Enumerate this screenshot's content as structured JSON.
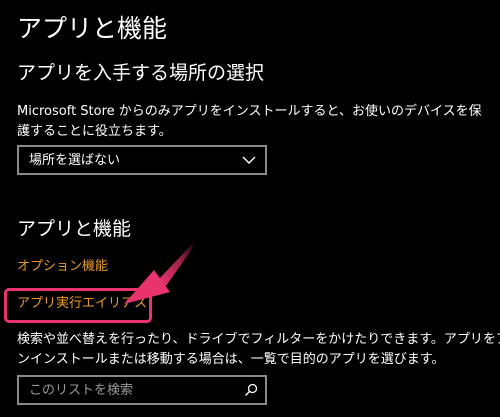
{
  "page": {
    "title": "アプリと機能"
  },
  "install_source": {
    "title": "アプリを入手する場所の選択",
    "description_lines": [
      "Microsoft Store からのみアプリをインストールすると、お使いのデバイスを保",
      "護することに役立ちます。"
    ],
    "dropdown_value": "場所を選ばない"
  },
  "apps_features": {
    "title": "アプリと機能",
    "links": {
      "optional_features": "オプション機能",
      "execution_alias": "アプリ実行エイリアス"
    },
    "description_lines": [
      "検索や並べ替えを行ったり、ドライブでフィルターをかけたりできます。アプリをア",
      "ンインストールまたは移動する場合は、一覧で目的のアプリを選びます。"
    ],
    "search_placeholder": "このリストを検索"
  },
  "colors": {
    "background": "#000000",
    "text": "#ffffff",
    "link": "#e89a2e",
    "highlight": "#e8336f",
    "border": "#8a8a8a"
  },
  "icons": {
    "dropdown": "chevron-down-icon",
    "search": "search-icon",
    "annotation": "arrow-annotation"
  }
}
